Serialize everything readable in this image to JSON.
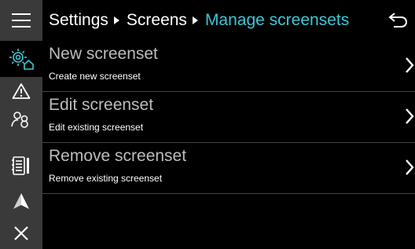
{
  "sidebar": {
    "items": [
      {
        "name": "menu-icon"
      },
      {
        "name": "screen-settings-icon"
      },
      {
        "name": "warning-icon"
      },
      {
        "name": "users-icon"
      },
      {
        "name": "manual-icon"
      },
      {
        "name": "navigation-icon"
      },
      {
        "name": "close-icon"
      }
    ]
  },
  "header": {
    "breadcrumb": [
      "Settings",
      "Screens",
      "Manage screensets"
    ],
    "back_icon": "back-icon"
  },
  "colors": {
    "accent": "#3ec6d6",
    "sidebar_bg": "#3a3a3a",
    "background": "#000000",
    "title_text": "#bdbdbd"
  },
  "list": {
    "items": [
      {
        "title": "New screenset",
        "description": "Create new screenset"
      },
      {
        "title": "Edit screenset",
        "description": "Edit existing screenset"
      },
      {
        "title": "Remove screenset",
        "description": "Remove existing screenset"
      }
    ]
  }
}
